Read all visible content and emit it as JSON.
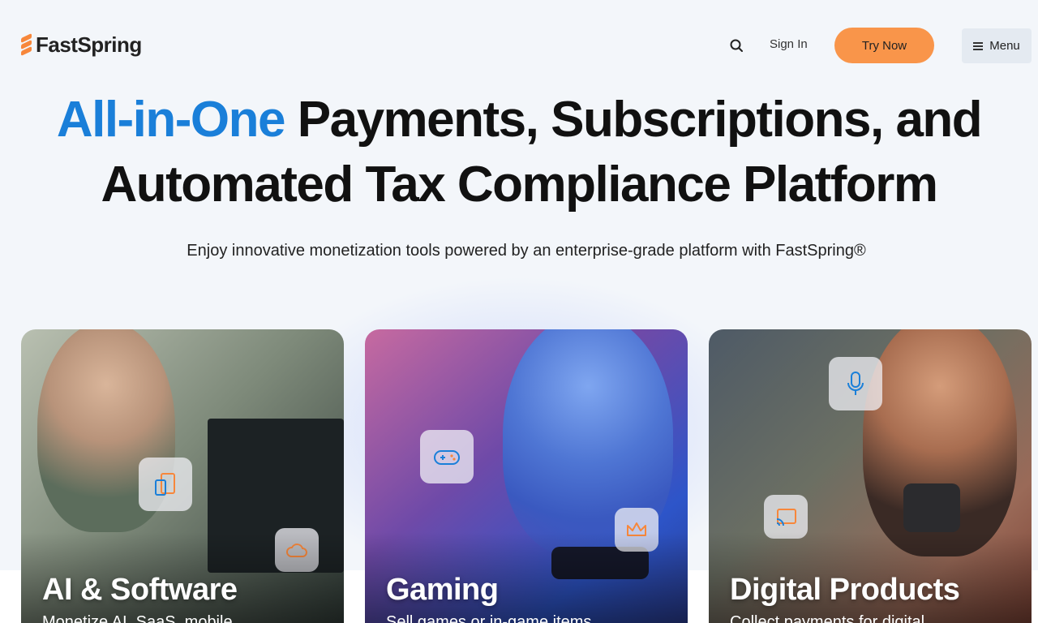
{
  "header": {
    "logo_text": "FastSpring",
    "signin_label": "Sign In",
    "try_now_label": "Try Now",
    "menu_label": "Menu"
  },
  "hero": {
    "title_accent": "All-in-One",
    "title_rest": " Payments, Subscriptions, and Automated Tax Compliance Platform",
    "subtitle": "Enjoy innovative monetization tools powered by an enterprise-grade platform with FastSpring®"
  },
  "cards": [
    {
      "title": "AI & Software",
      "description": "Monetize AI, SaaS, mobile",
      "icons": [
        "devices-icon",
        "cloud-icon"
      ]
    },
    {
      "title": "Gaming",
      "description": "Sell games or in-game items",
      "icons": [
        "gamepad-icon",
        "crown-icon"
      ]
    },
    {
      "title": "Digital Products",
      "description": "Collect payments for digital",
      "icons": [
        "microphone-icon",
        "cast-icon"
      ]
    }
  ],
  "colors": {
    "accent_blue": "#1a7fd9",
    "brand_orange": "#f9954a",
    "menu_bg": "#e4eaf1",
    "page_bg": "#f3f6fa"
  }
}
